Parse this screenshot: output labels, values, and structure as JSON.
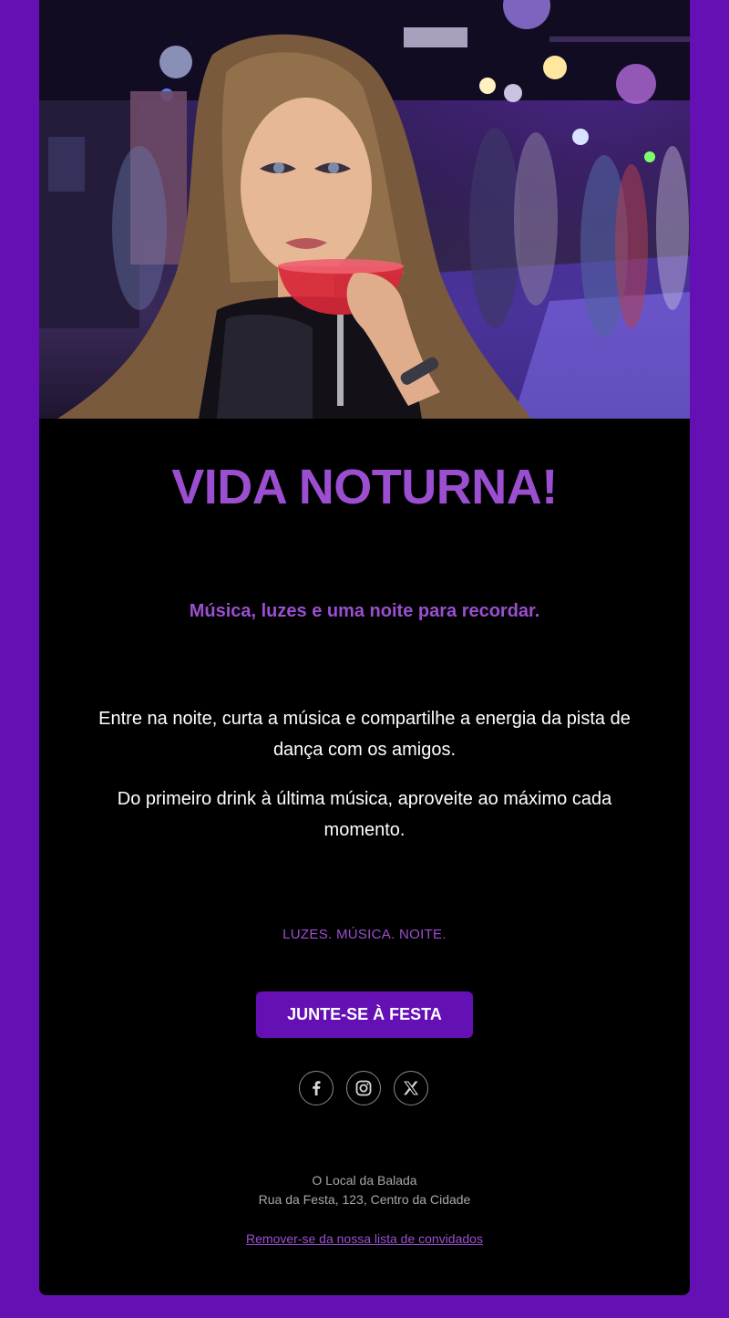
{
  "hero": {
    "image": "nightclub-woman-with-cocktail"
  },
  "email": {
    "headline": "VIDA NOTURNA!",
    "subtitle": "Música, luzes e uma noite para recordar.",
    "paragraphs": [
      "Entre na noite, curta a música e compartilhe a energia da pista de dança com os amigos.",
      "Do primeiro drink à última música, aproveite ao máximo cada momento."
    ],
    "tagline": "LUZES. MÚSICA. NOITE.",
    "cta_label": "JUNTE-SE À FESTA",
    "social": [
      "facebook-icon",
      "instagram-icon",
      "x-icon"
    ],
    "venue_name": "O Local da Balada",
    "venue_address": "Rua da Festa, 123, Centro da Cidade",
    "unsubscribe_label": "Remover-se da nossa lista de convidados"
  },
  "colors": {
    "page_background": "#6410b4",
    "card_background": "#000000",
    "accent": "#9b4fd0",
    "button": "#6410b4",
    "muted_text": "#a7a7a7"
  }
}
